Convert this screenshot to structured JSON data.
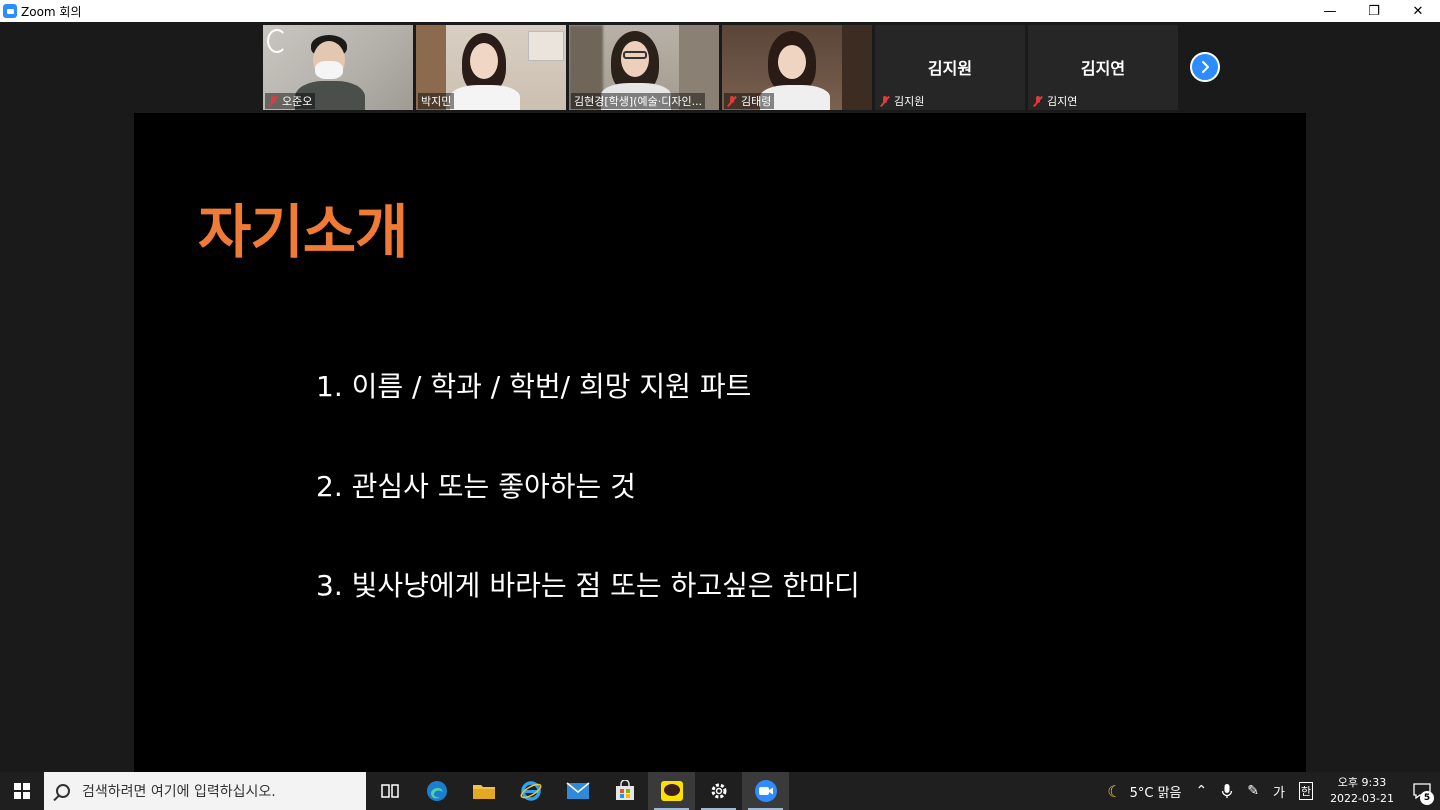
{
  "window": {
    "title": "Zoom 회의",
    "minimize_glyph": "—",
    "restore_glyph": "❐",
    "close_glyph": "✕"
  },
  "participants": [
    {
      "name": "오준오",
      "muted": true,
      "video": true
    },
    {
      "name": "박지민",
      "muted": false,
      "video": true
    },
    {
      "name": "김현경[학생](예술·디자인...",
      "muted": false,
      "video": true,
      "active_speaker": true
    },
    {
      "name": "김태령",
      "muted": true,
      "video": true
    },
    {
      "name": "김지원",
      "muted": true,
      "video": false,
      "display_name": "김지원"
    },
    {
      "name": "김지연",
      "muted": true,
      "video": false,
      "display_name": "김지연"
    }
  ],
  "slide": {
    "title": "자기소개",
    "items": [
      "1. 이름 / 학과 / 학번/ 희망 지원 파트",
      "2. 관심사 또는 좋아하는 것",
      "3. 빛사냥에게 바라는 점 또는 하고싶은 한마디"
    ]
  },
  "taskbar": {
    "search_placeholder": "검색하려면 여기에 입력하십시오.",
    "weather": "5°C  맑음",
    "ime_lang": "가",
    "ime_mode": "한",
    "time": "오후 9:33",
    "date": "2022-03-21",
    "notification_count": "5"
  },
  "colors": {
    "accent": "#f07b36",
    "zoom_blue": "#2d8cff",
    "muted_red": "#e03a3a"
  }
}
